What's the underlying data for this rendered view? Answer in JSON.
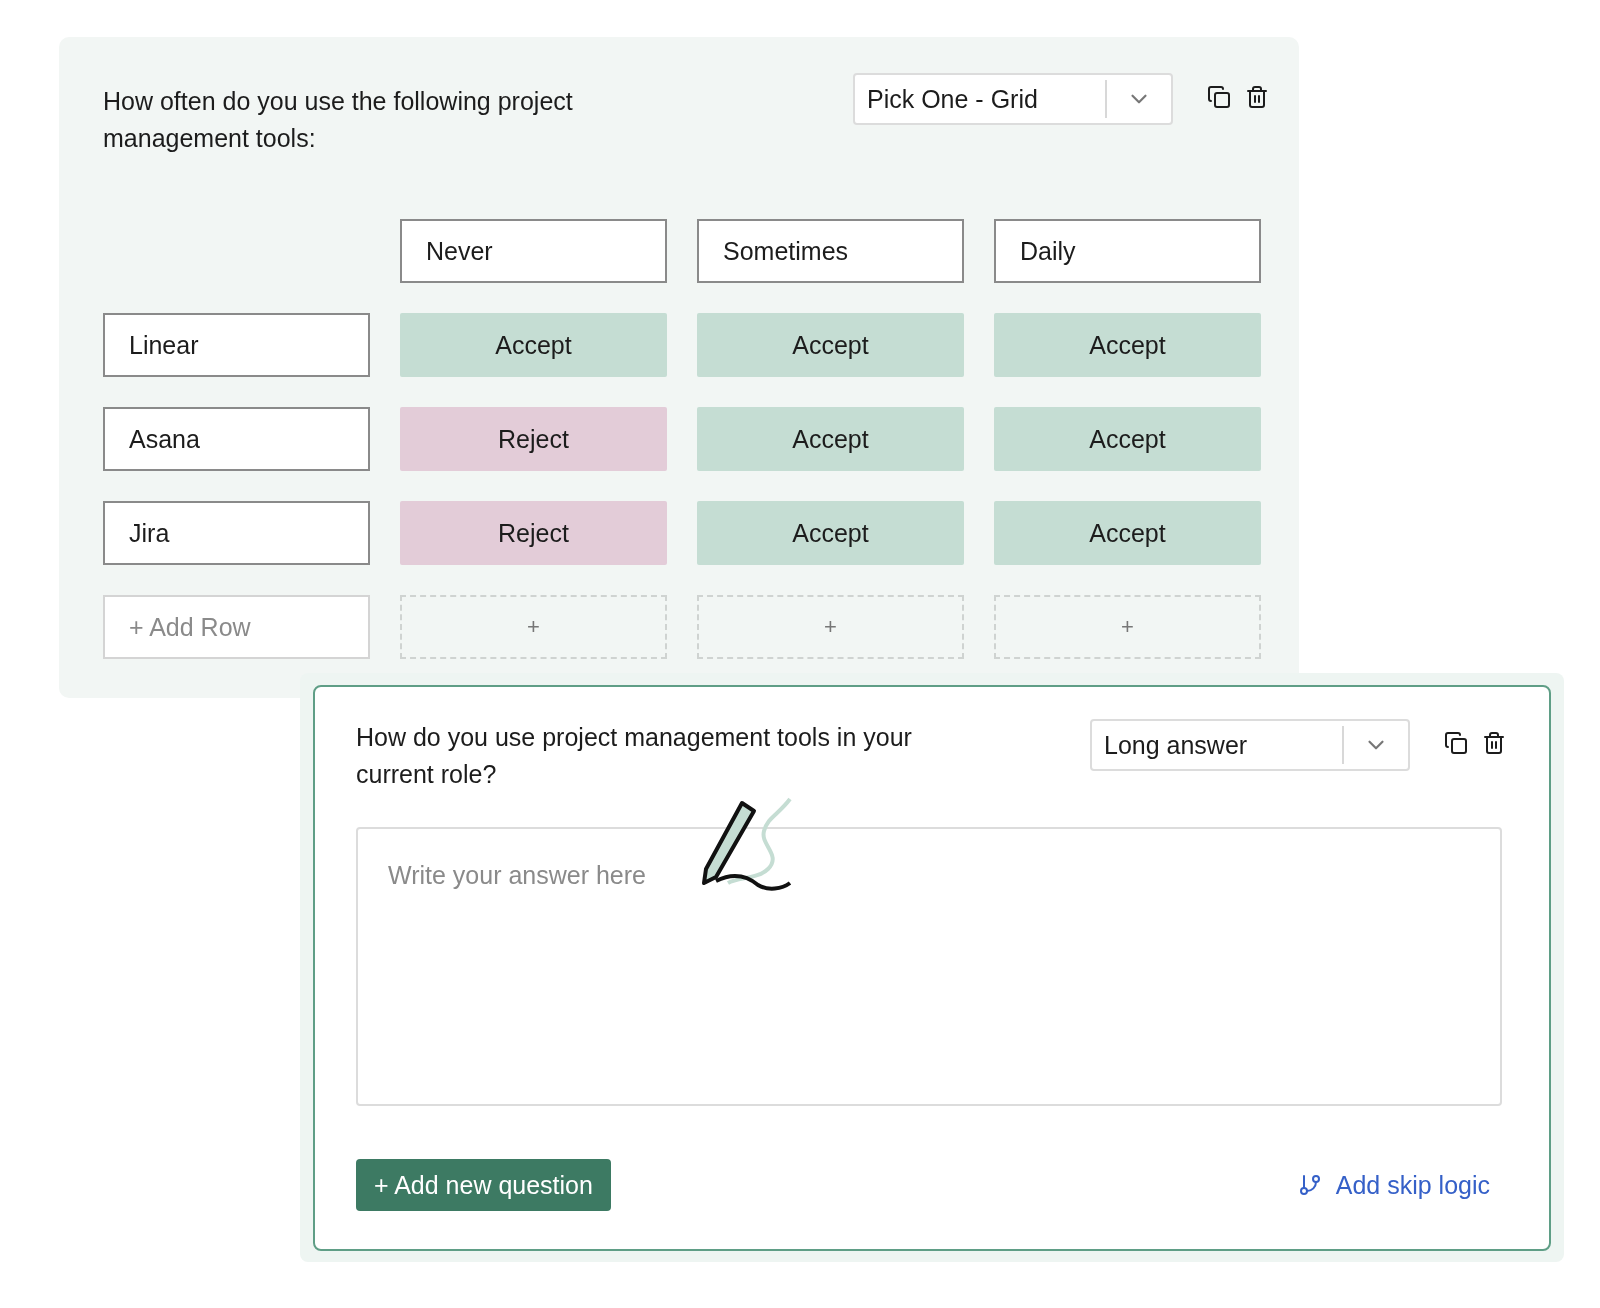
{
  "grid_question": {
    "title": "How often do you use the following project management tools:",
    "type_select": {
      "value": "Pick One - Grid"
    },
    "columns": [
      "Never",
      "Sometimes",
      "Daily"
    ],
    "rows": [
      {
        "label": "Linear",
        "cells": [
          {
            "kind": "accept",
            "label": "Accept"
          },
          {
            "kind": "accept",
            "label": "Accept"
          },
          {
            "kind": "accept",
            "label": "Accept"
          }
        ]
      },
      {
        "label": "Asana",
        "cells": [
          {
            "kind": "reject",
            "label": "Reject"
          },
          {
            "kind": "accept",
            "label": "Accept"
          },
          {
            "kind": "accept",
            "label": "Accept"
          }
        ]
      },
      {
        "label": "Jira",
        "cells": [
          {
            "kind": "reject",
            "label": "Reject"
          },
          {
            "kind": "accept",
            "label": "Accept"
          },
          {
            "kind": "accept",
            "label": "Accept"
          }
        ]
      }
    ],
    "add_row": "+ Add Row",
    "add_cells": [
      "+",
      "+",
      "+"
    ]
  },
  "text_question": {
    "title": "How do you use project management tools in your current role?",
    "type_select": {
      "value": "Long answer"
    },
    "answer": {
      "placeholder": "Write your answer here"
    },
    "add_question_button": "+ Add new question",
    "skip_logic_link": "Add skip logic"
  }
}
